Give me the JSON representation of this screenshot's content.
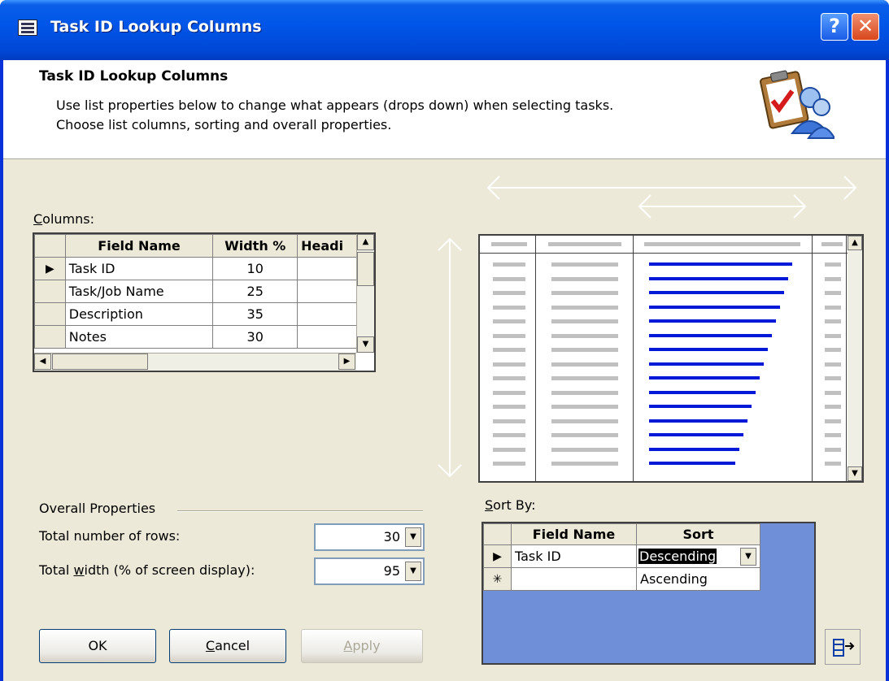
{
  "window": {
    "title": "Task ID Lookup Columns",
    "help_glyph": "?",
    "close_glyph": "✕"
  },
  "header": {
    "title": "Task ID Lookup Columns",
    "line1": "Use list properties below to change what appears (drops down) when selecting tasks.",
    "line2": "Choose list columns, sorting and overall properties."
  },
  "columns": {
    "label_mnemonic": "C",
    "label_rest": "olumns:",
    "headers": [
      "Field Name",
      "Width %",
      "Headi"
    ],
    "rows": [
      {
        "name": "Task ID",
        "width": "10"
      },
      {
        "name": "Task/Job Name",
        "width": "25"
      },
      {
        "name": "Description",
        "width": "35"
      },
      {
        "name": "Notes",
        "width": "30"
      }
    ]
  },
  "overall": {
    "title": "Overall Properties",
    "rows_label": "Total number of rows:",
    "rows_value": "30",
    "width_label_pre": "Total ",
    "width_label_mnemonic": "w",
    "width_label_post": "idth (% of screen display):",
    "width_value": "95"
  },
  "sort": {
    "label_mnemonic": "S",
    "label_rest": "ort By:",
    "headers": [
      "Field Name",
      "Sort"
    ],
    "rows": [
      {
        "marker": "▶",
        "field": "Task ID",
        "sort": "Descending"
      },
      {
        "marker": "✳",
        "field": "",
        "sort": "Ascending"
      }
    ]
  },
  "buttons": {
    "ok": "OK",
    "cancel_mnemonic": "C",
    "cancel_rest": "ancel",
    "apply_mnemonic": "A",
    "apply_rest": "pply"
  },
  "colors": {
    "title_bar": "#0a5ee8",
    "dialog_bg": "#ece9d8",
    "sort_panel": "#6f8fd9",
    "preview_line": "#0018d8"
  }
}
